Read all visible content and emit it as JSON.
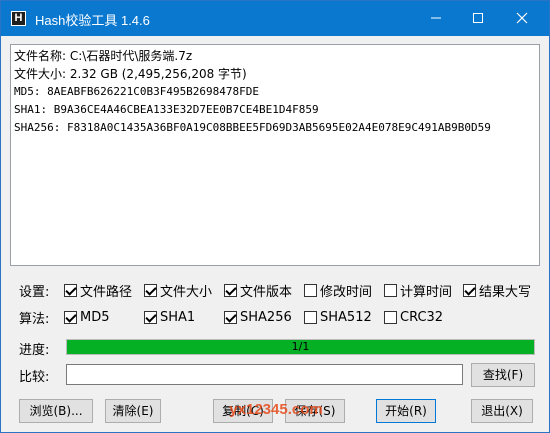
{
  "window": {
    "title": "Hash校验工具 1.4.6",
    "icon_letter": "H",
    "controls": [
      "minimize-icon",
      "maximize-icon",
      "close-icon"
    ]
  },
  "output": {
    "file_name_label": "文件名称:",
    "file_name": "C:\\石器时代\\服务端.7z",
    "file_size_label": "文件大小:",
    "file_size": "2.32 GB (2,495,256,208 字节)",
    "md5": "MD5: 8AEABFB626221C0B3F495B2698478FDE",
    "sha1": "SHA1: B9A36CE4A46CBEA133E32D7EE0B7CE4BE1D4F859",
    "sha256": "SHA256: F8318A0C1435A36BF0A19C08BBEE5FD69D3AB5695E02A4E078E9C491AB9B0D59"
  },
  "settings": {
    "label": "设置:",
    "options": [
      {
        "label": "文件路径",
        "checked": true
      },
      {
        "label": "文件大小",
        "checked": true
      },
      {
        "label": "文件版本",
        "checked": true
      },
      {
        "label": "修改时间",
        "checked": false
      },
      {
        "label": "计算时间",
        "checked": false
      },
      {
        "label": "结果大写",
        "checked": true
      }
    ]
  },
  "algorithms": {
    "label": "算法:",
    "options": [
      {
        "label": "MD5",
        "checked": true
      },
      {
        "label": "SHA1",
        "checked": true
      },
      {
        "label": "SHA256",
        "checked": true
      },
      {
        "label": "SHA512",
        "checked": false
      },
      {
        "label": "CRC32",
        "checked": false
      }
    ]
  },
  "progress": {
    "label": "进度:",
    "text": "1/1",
    "fraction": 1.0,
    "color": "#06b025"
  },
  "compare": {
    "label": "比较:",
    "value": "",
    "find_button": "查找(F)"
  },
  "buttons": {
    "browse": "浏览(B)...",
    "clear": "清除(E)",
    "copy": "复制(C)",
    "save": "保存(S)",
    "start": "开始(R)",
    "exit": "退出(X)"
  },
  "watermark": "yx12345.com",
  "colors": {
    "titlebar": "#0b78d0",
    "progress_fill": "#06b025"
  }
}
